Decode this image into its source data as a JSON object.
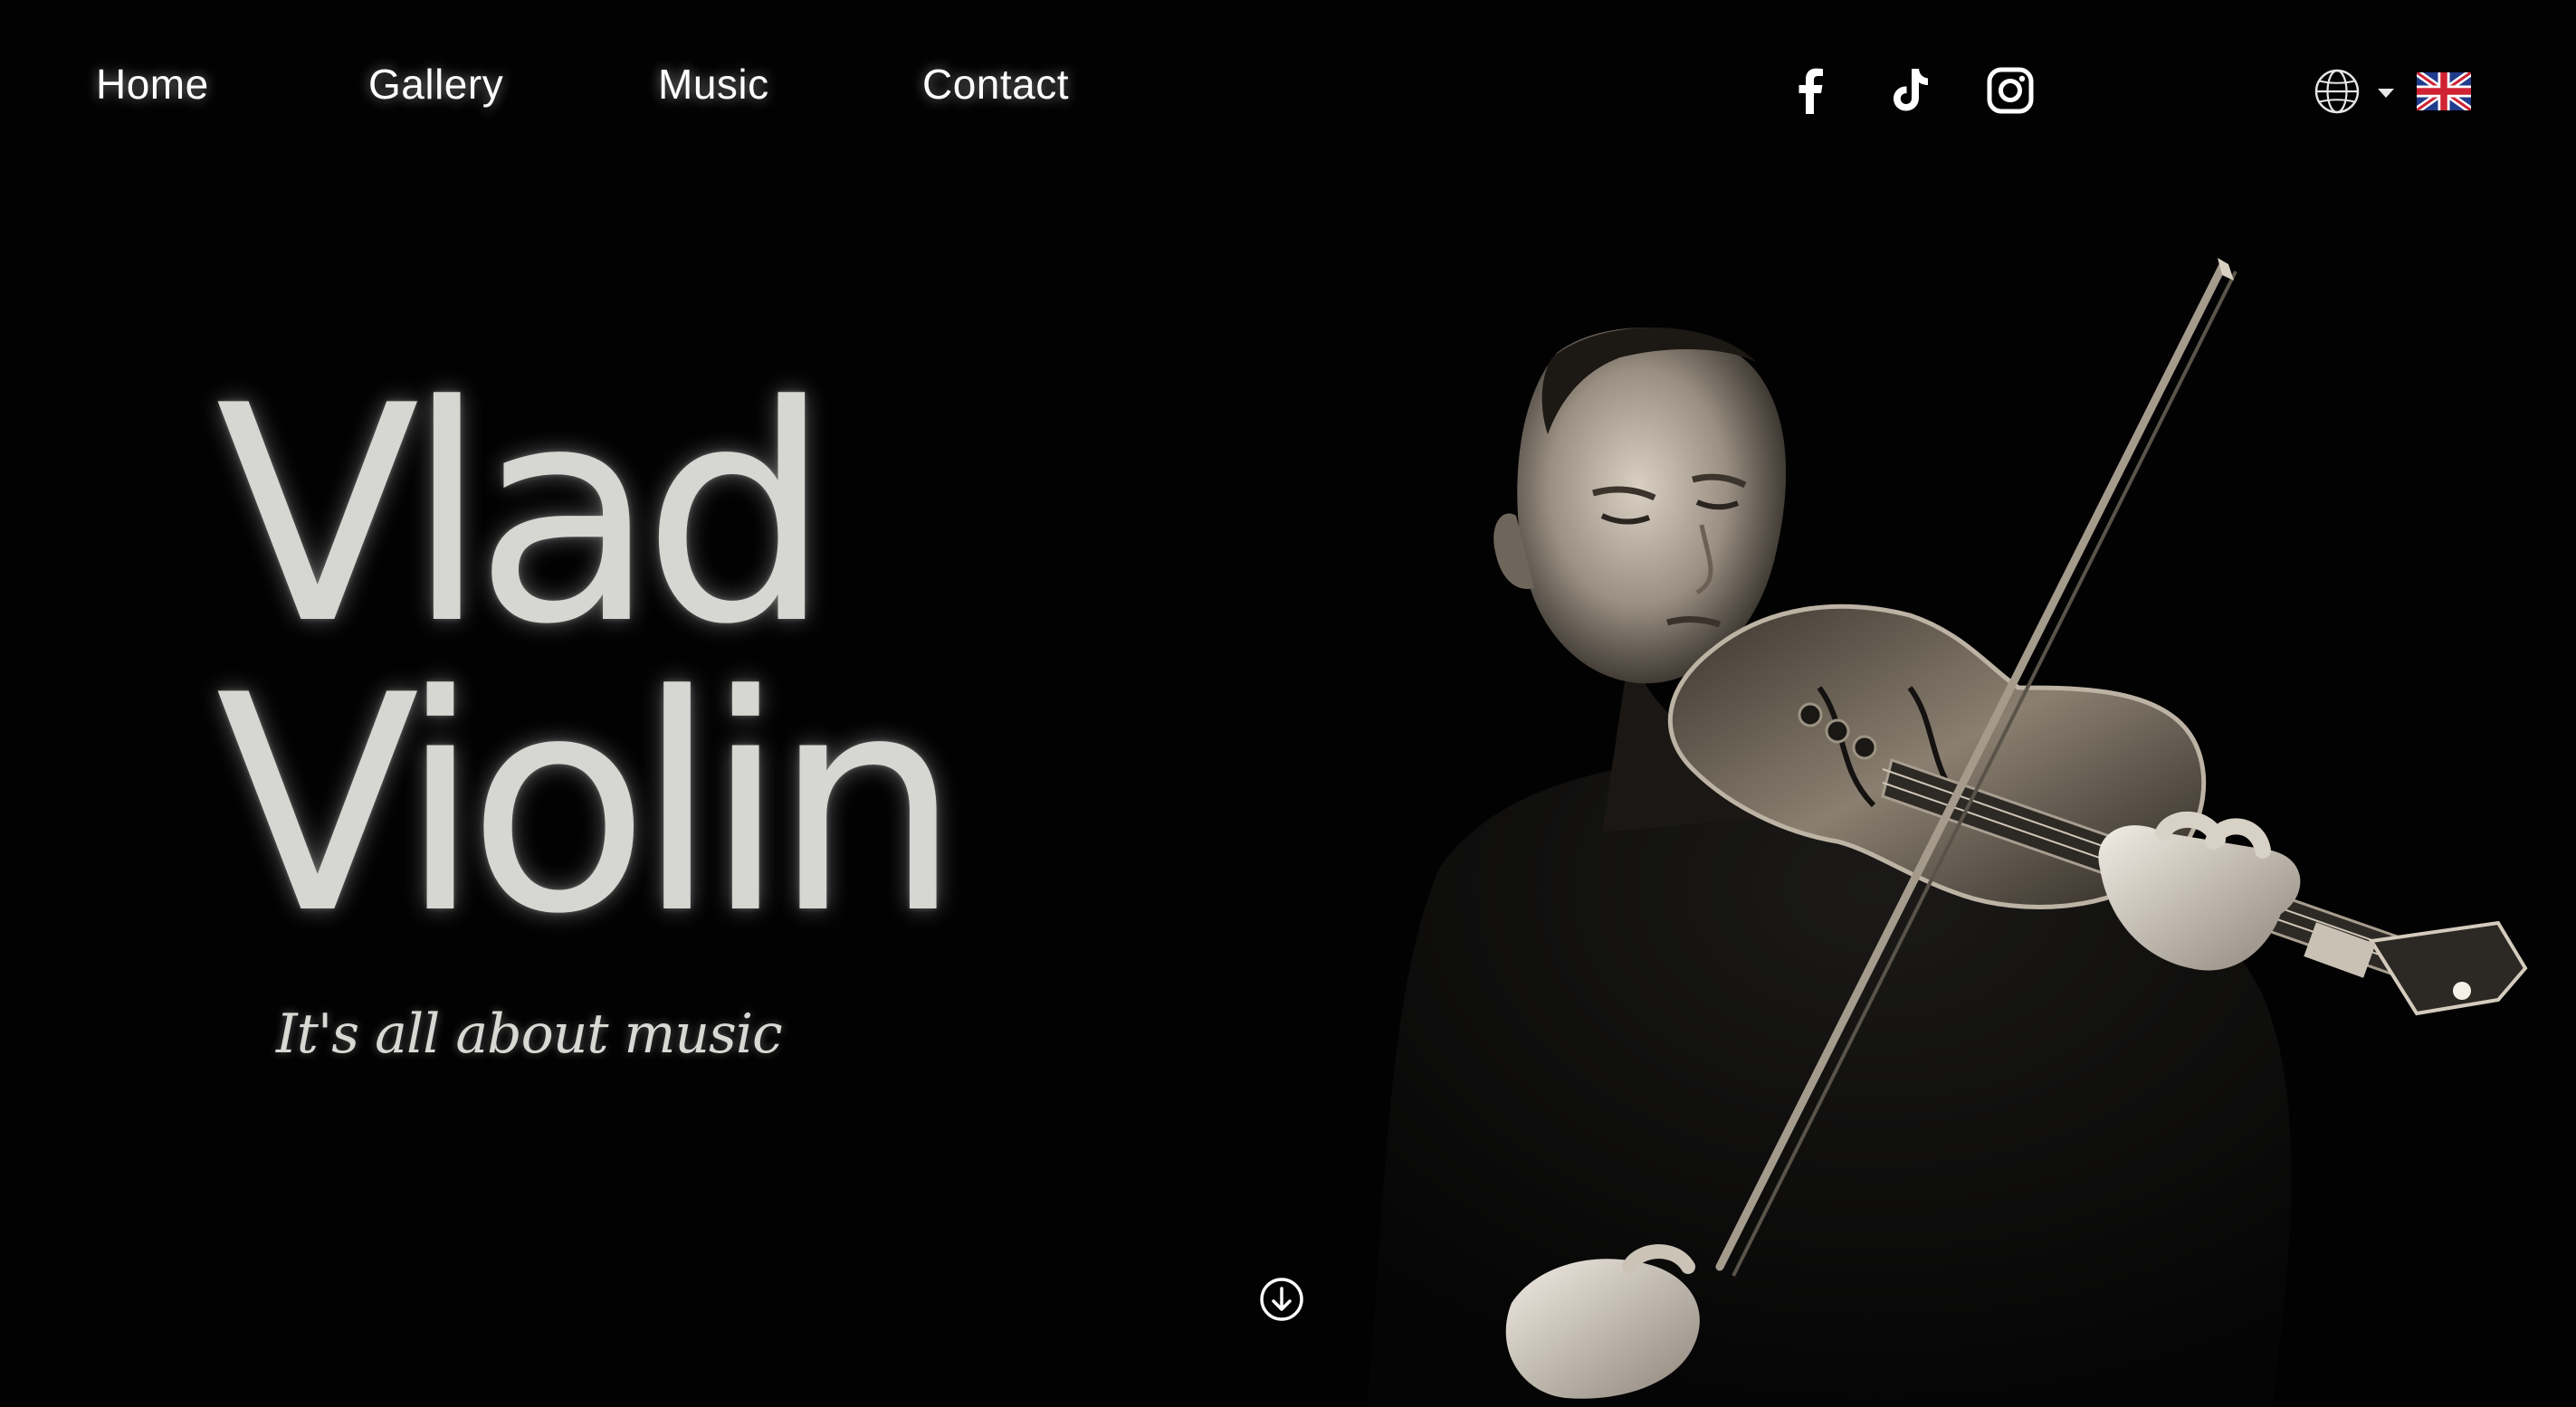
{
  "nav": {
    "items": [
      {
        "label": "Home"
      },
      {
        "label": "Gallery"
      },
      {
        "label": "Music"
      },
      {
        "label": "Contact"
      }
    ]
  },
  "social": [
    {
      "icon": "facebook-icon"
    },
    {
      "icon": "tiktok-icon"
    },
    {
      "icon": "instagram-icon"
    }
  ],
  "language": {
    "icon": "globe-icon",
    "selected_flag": "uk-flag-icon"
  },
  "hero": {
    "title_line1": "Vlad",
    "title_line2": "Violin",
    "tagline": "It's all about music"
  },
  "scroll": {
    "icon": "arrow-down-circle-icon"
  },
  "colors": {
    "background": "#020202",
    "title": "#d6d6d2",
    "nav_text": "#ffffff"
  }
}
